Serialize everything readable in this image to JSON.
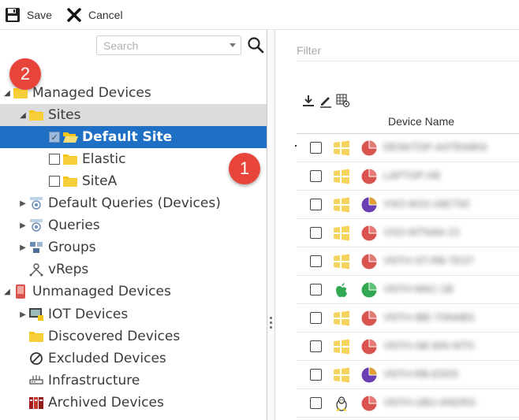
{
  "toolbar": {
    "save_label": "Save",
    "cancel_label": "Cancel"
  },
  "left": {
    "search_placeholder": "Search",
    "badge_two": "2",
    "badge_one": "1",
    "tree": {
      "managed": "Managed Devices",
      "sites": "Sites",
      "default_site": "Default Site",
      "elastic": "Elastic",
      "sitea": "SiteA",
      "default_queries": "Default Queries (Devices)",
      "queries": "Queries",
      "groups": "Groups",
      "vreps": "vReps",
      "unmanaged": "Unmanaged Devices",
      "iot": "IOT Devices",
      "discovered": "Discovered Devices",
      "excluded": "Excluded Devices",
      "infrastructure": "Infrastructure",
      "archived": "Archived Devices"
    }
  },
  "right": {
    "filter_placeholder": "Filter",
    "column_device_name": "Device Name",
    "rows": [
      {
        "os": "windows",
        "status": "red",
        "name": "DESKTOP-A4TRA9K6"
      },
      {
        "os": "windows",
        "status": "red",
        "name": "LAPTOP-H8"
      },
      {
        "os": "windows",
        "status": "purple",
        "name": "VSO-W10-16E7S0"
      },
      {
        "os": "windows",
        "status": "red",
        "name": "VSO-WTNAK-21"
      },
      {
        "os": "windows",
        "status": "red",
        "name": "VNTH-ST-RB-TEST"
      },
      {
        "os": "apple",
        "status": "green",
        "name": "VNTH-MAC-1B"
      },
      {
        "os": "windows",
        "status": "red",
        "name": "VNTH-IBE-T0NABS"
      },
      {
        "os": "windows",
        "status": "red",
        "name": "VNTH-SB-WN-WT0"
      },
      {
        "os": "windows",
        "status": "purple",
        "name": "VNTH-RB-ED03"
      },
      {
        "os": "linux",
        "status": "red",
        "name": "VNTH-UBU-ANDRS"
      }
    ]
  },
  "colors": {
    "selection": "#1f6fc5",
    "badge": "#e8443a",
    "folder": "#f5c518",
    "windows": "#f4d03f",
    "apple": "#34a853",
    "red_status": "#d9534f",
    "purple_status": "#6a3fb5",
    "green_status": "#34a853"
  }
}
